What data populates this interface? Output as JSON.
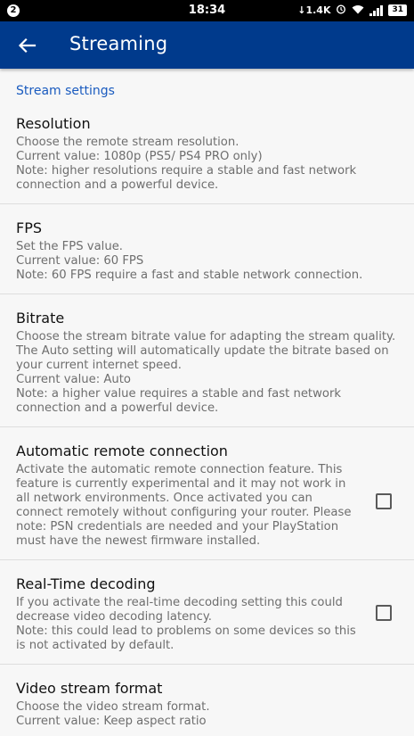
{
  "status_bar": {
    "notification_badge": "2",
    "time": "18:34",
    "network_speed": "1.4K",
    "battery": "31"
  },
  "app_bar": {
    "title": "Streaming"
  },
  "section": {
    "header": "Stream settings"
  },
  "preferences": [
    {
      "title": "Resolution",
      "lines": [
        "Choose the remote stream resolution.",
        "Current value: 1080p (PS5/ PS4 PRO only)",
        "Note: higher resolutions require a stable and fast network connection and a powerful device."
      ]
    },
    {
      "title": "FPS",
      "lines": [
        "Set the FPS value.",
        "Current value: 60 FPS",
        "Note: 60 FPS require a fast and stable network connection."
      ]
    },
    {
      "title": "Bitrate",
      "lines": [
        "Choose the stream bitrate value for adapting the stream quality. The Auto setting will automatically update the bitrate based on your current internet speed.",
        "Current value: Auto",
        "Note: a higher value requires a stable and fast network connection and a powerful device."
      ]
    },
    {
      "title": "Automatic remote connection",
      "lines": [
        "Activate the automatic remote connection feature. This feature is currently experimental and it may not work in all network environments. Once activated you can connect remotely without configuring your router. Please note: PSN credentials are needed and your PlayStation must have the newest firmware installed."
      ],
      "checked": false
    },
    {
      "title": "Real-Time decoding",
      "lines": [
        "If you activate the real-time decoding setting this could decrease video decoding latency.",
        "Note: this could lead to problems on some devices so this is not activated by default."
      ],
      "checked": false
    },
    {
      "title": "Video stream format",
      "lines": [
        "Choose the video stream format.",
        "Current value: Keep aspect ratio"
      ]
    }
  ]
}
